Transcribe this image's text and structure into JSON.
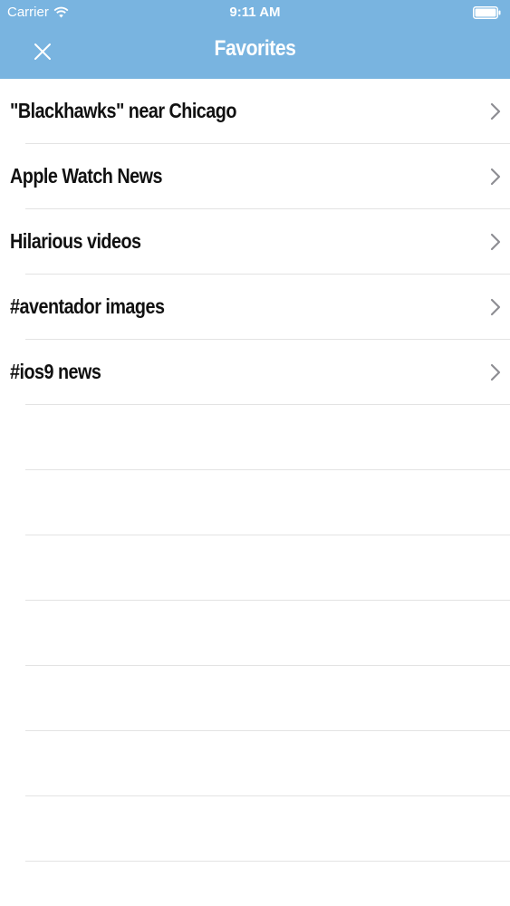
{
  "status_bar": {
    "carrier": "Carrier",
    "time": "9:11 AM",
    "wifi_icon": "wifi-icon",
    "battery_icon": "battery-icon"
  },
  "nav": {
    "title": "Favorites",
    "close_icon": "close-icon",
    "background_color": "#79b4e0"
  },
  "favorites": [
    {
      "label": "\"Blackhawks\" near Chicago"
    },
    {
      "label": "Apple Watch News"
    },
    {
      "label": "Hilarious videos"
    },
    {
      "label": "#aventador images"
    },
    {
      "label": "#ios9 news"
    }
  ],
  "row_icon": "chevron-right-icon"
}
